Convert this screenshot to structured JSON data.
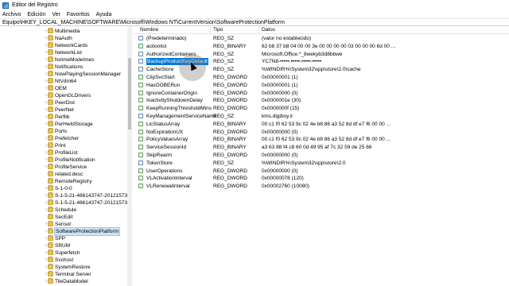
{
  "window": {
    "title": "Editor del Registro"
  },
  "menu": [
    "Archivo",
    "Edición",
    "Ver",
    "Favoritos",
    "Ayuda"
  ],
  "address": "Equipo\\HKEY_LOCAL_MACHINE\\SOFTWARE\\Microsoft\\Windows NT\\CurrentVersion\\SoftwareProtectionPlatform",
  "tree": [
    {
      "label": "Multimedia",
      "expandable": true
    },
    {
      "label": "NaAuth",
      "expandable": true
    },
    {
      "label": "NetworkCards",
      "expandable": true
    },
    {
      "label": "NetworkList",
      "expandable": true
    },
    {
      "label": "NoImeModeImes",
      "expandable": true
    },
    {
      "label": "Notifications",
      "expandable": true
    },
    {
      "label": "NowPlayingSessionManager",
      "expandable": true
    },
    {
      "label": "NtVdm64",
      "expandable": true
    },
    {
      "label": "OEM",
      "expandable": true
    },
    {
      "label": "OpenGLDrivers",
      "expandable": true
    },
    {
      "label": "PeerDist",
      "expandable": true
    },
    {
      "label": "PeerNet",
      "expandable": true
    },
    {
      "label": "Perflib",
      "expandable": true
    },
    {
      "label": "PerHwIdStorage",
      "expandable": true
    },
    {
      "label": "Ports",
      "expandable": false
    },
    {
      "label": "Prefetcher",
      "expandable": true
    },
    {
      "label": "Print",
      "expandable": true
    },
    {
      "label": "ProfileList",
      "expandable": true
    },
    {
      "label": "ProfileNotification",
      "expandable": true
    },
    {
      "label": "ProfileService",
      "expandable": true
    },
    {
      "label": "related.desc",
      "expandable": false
    },
    {
      "label": "RemoteRegistry",
      "expandable": false
    },
    {
      "label": "S-1-0-0",
      "expandable": true
    },
    {
      "label": "S-1-5-21-466143747-2012157364-36",
      "expandable": true
    },
    {
      "label": "S-1-5-21-466143747-2012157364-36",
      "expandable": true
    },
    {
      "label": "Schedule",
      "expandable": true
    },
    {
      "label": "SecEdit",
      "expandable": false
    },
    {
      "label": "Sensor",
      "expandable": true
    },
    {
      "label": "SoftwareProtectionPlatform",
      "expandable": true,
      "selected": true
    },
    {
      "label": "SPP",
      "expandable": true
    },
    {
      "label": "SRUM",
      "expandable": true
    },
    {
      "label": "Superfetch",
      "expandable": true
    },
    {
      "label": "Svchost",
      "expandable": true
    },
    {
      "label": "SystemRestore",
      "expandable": true
    },
    {
      "label": "Terminal Server",
      "expandable": true
    },
    {
      "label": "TileDataModel",
      "expandable": true
    }
  ],
  "columns": {
    "name": "Nombre",
    "type": "Tipo",
    "data": "Datos"
  },
  "values": [
    {
      "name": "(Predeterminado)",
      "type": "REG_SZ",
      "data": "(valor no establecido)",
      "kind": "sz"
    },
    {
      "name": "actionlist",
      "type": "REG_BINARY",
      "data": "62 b8 37 b8 04 00 00 3e 00 00 00 00 03 00 00 00 6d 00 ...",
      "kind": "bin"
    },
    {
      "name": "AuthorizedContainers",
      "type": "REG_SZ",
      "data": "Microsoft.Office.*_8wekyb3d8bbwe",
      "kind": "sz"
    },
    {
      "name": "BackupProductKeyDefault",
      "type": "REG_SZ",
      "data": "YC7N8-•••••-•••••-•••••-•••••",
      "kind": "sz",
      "selected": true
    },
    {
      "name": "CacheStore",
      "type": "REG_SZ",
      "data": "%WINDIR%\\System32\\spp\\store\\2.0\\cache",
      "kind": "sz"
    },
    {
      "name": "ClipSvcStart",
      "type": "REG_DWORD",
      "data": "0x00000001 (1)",
      "kind": "bin"
    },
    {
      "name": "HasOOBERun",
      "type": "REG_DWORD",
      "data": "0x00000001 (1)",
      "kind": "bin"
    },
    {
      "name": "IgnoreContainerOrigin",
      "type": "REG_DWORD",
      "data": "0x00000000 (0)",
      "kind": "bin"
    },
    {
      "name": "InactivityShutdownDelay",
      "type": "REG_DWORD",
      "data": "0x0000001e (30)",
      "kind": "bin"
    },
    {
      "name": "KeepRunningThresholdMins",
      "type": "REG_DWORD",
      "data": "0x0000000f (15)",
      "kind": "bin"
    },
    {
      "name": "KeyManagementServiceName",
      "type": "REG_SZ",
      "data": "kms.digiboy.ir",
      "kind": "sz"
    },
    {
      "name": "LicStatusArray",
      "type": "REG_BINARY",
      "data": "00 c1 f0 62 53 9c 02 4e b8 86 a3 52 8d df e7 f6 00 00 ...",
      "kind": "bin"
    },
    {
      "name": "NoExpirationUX",
      "type": "REG_DWORD",
      "data": "0x00000000 (0)",
      "kind": "bin"
    },
    {
      "name": "PolicyValuesArray",
      "type": "REG_BINARY",
      "data": "00 c1 f0 62 53 9c 02 4e b8 86 a3 52 8d df e7 f6 00 00 ...",
      "kind": "bin"
    },
    {
      "name": "ServiceSessionId",
      "type": "REG_BINARY",
      "data": "a3 63 88 f4 c8 60 0d 49 95 af 7c 32 59 de 25 66",
      "kind": "bin"
    },
    {
      "name": "SkipRearm",
      "type": "REG_DWORD",
      "data": "0x00000000 (0)",
      "kind": "bin"
    },
    {
      "name": "TokenStore",
      "type": "REG_SZ",
      "data": "%WINDIR%\\System32\\spp\\store\\2.0",
      "kind": "sz"
    },
    {
      "name": "UserOperations",
      "type": "REG_DWORD",
      "data": "0x00000000 (0)",
      "kind": "bin"
    },
    {
      "name": "VLActivationInterval",
      "type": "REG_DWORD",
      "data": "0x00000078 (120)",
      "kind": "bin"
    },
    {
      "name": "VLRenewalInterval",
      "type": "REG_DWORD",
      "data": "0x00002760 (10080)",
      "kind": "bin"
    }
  ]
}
